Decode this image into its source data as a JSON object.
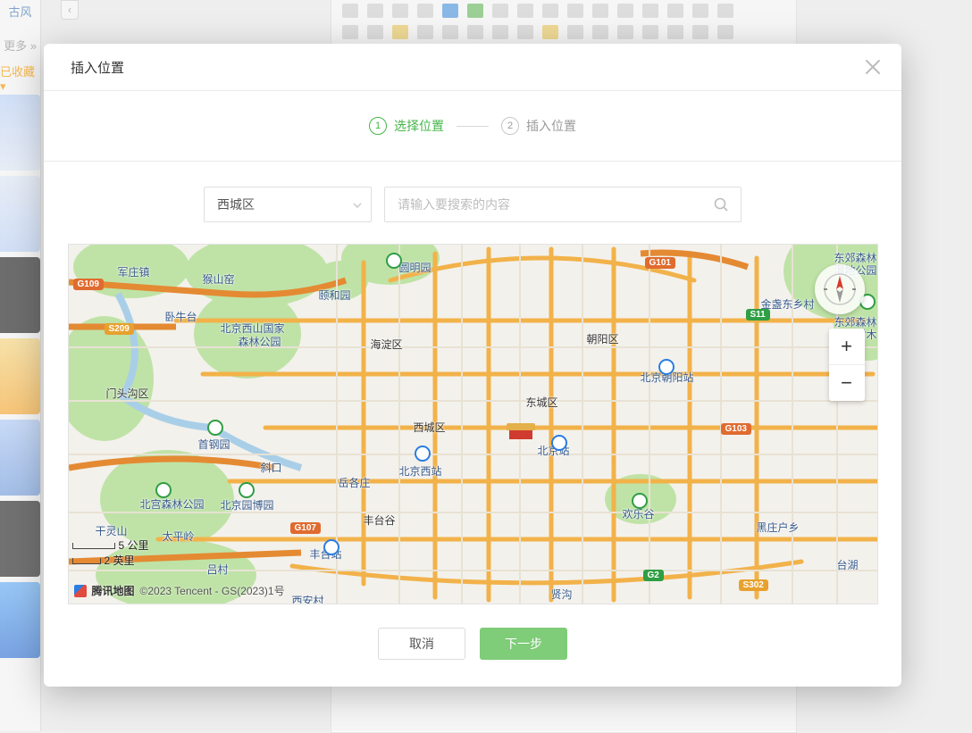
{
  "bg": {
    "sidebar_tag": "古风",
    "sidebar_more": "更多 »",
    "favorite": "已收藏 ▾",
    "collapse_glyph": "‹"
  },
  "modal": {
    "title": "插入位置",
    "steps": [
      {
        "num": "1",
        "label": "选择位置"
      },
      {
        "num": "2",
        "label": "插入位置"
      }
    ],
    "region_select": {
      "value": "西城区"
    },
    "search": {
      "placeholder": "请输入要搜索的内容"
    },
    "cancel": "取消",
    "next": "下一步"
  },
  "map": {
    "scale_km": "5 公里",
    "scale_mi": "2 英里",
    "brand": "腾讯地图",
    "copyright": "©2023 Tencent - GS(2023)1号",
    "zoom_in": "+",
    "zoom_out": "−",
    "labels": {
      "junzhuangzhen": "军庄镇",
      "houshanyao": "猴山窑",
      "wolitai": "卧牛台",
      "beijingxishan": "北京西山国家",
      "senlingongyuan": "森林公园",
      "mentougou": "门头沟区",
      "shigangyuan": "首钢园",
      "xiekou": "斜口",
      "beigongsenlin": "北宫森林公园",
      "beijingyuanboyuan": "北京园博园",
      "ganlingshan": "干灵山",
      "taipingling": "太平岭",
      "lvcun": "吕村",
      "yiheyuan": "颐和园",
      "yuanmingyuan": "圆明园",
      "haidian": "海淀区",
      "yuezhuang": "岳各庄",
      "beijingxizhan": "北京西站",
      "xicheng": "西城区",
      "fengtai": "丰台谷",
      "fengtaizhan": "丰台站",
      "xiancun": "西安村",
      "dongcheng": "东城区",
      "beijingzhan": "北京站",
      "guanyin": "贤沟",
      "chaoyang": "朝阳区",
      "beijingchaoyang": "北京朝阳站",
      "huanlegu": "欢乐谷",
      "heizhuanghu": "黑庄户乡",
      "taihu": "台湖",
      "jinzhandongxiang": "金盏东乡村",
      "dongjiaoforest1": "东郊森林",
      "dongjiaoforest2": "湿地公园",
      "dongjiaoforest3": "东郊森林",
      "dongjiaoforest4": "华北树木"
    },
    "roads": {
      "g109": "G109",
      "s209": "S209",
      "g107": "G107",
      "g101": "G101",
      "s11": "S11",
      "g103": "G103",
      "g2": "G2",
      "s302": "S302"
    }
  }
}
